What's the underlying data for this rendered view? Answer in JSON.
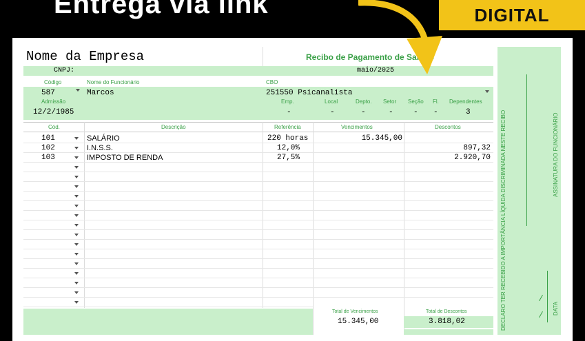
{
  "banner": {
    "title": "Entrega via link",
    "badge": "DIGITAL"
  },
  "header": {
    "company": "Nome da Empresa",
    "title": "Recibo de Pagamento de Salário",
    "cnpj_label": "CNPJ:",
    "period": "maio/2025"
  },
  "employee": {
    "labels": {
      "codigo": "Código",
      "nome": "Nome do Funcionário",
      "cbo": "CBO",
      "admissao": "Admissão",
      "emp": "Emp.",
      "local": "Local",
      "depto": "Depto.",
      "setor": "Setor",
      "secao": "Seção",
      "fl": "Fl.",
      "dependentes": "Dependentes"
    },
    "codigo": "587",
    "nome": "Marcos",
    "cbo": "251550 Psicanalista",
    "admissao": "12/2/1985",
    "emp": "-",
    "local": "-",
    "depto": "-",
    "setor": "-",
    "secao": "-",
    "fl": "-",
    "dependentes": "3"
  },
  "table": {
    "headers": {
      "cod": "Cód.",
      "descricao": "Descrição",
      "referencia": "Referência",
      "vencimentos": "Vencimentos",
      "descontos": "Descontos"
    },
    "rows": [
      {
        "cod": "101",
        "descricao": "SALÁRIO",
        "referencia": "220 horas",
        "vencimentos": "15.345,00",
        "descontos": ""
      },
      {
        "cod": "102",
        "descricao": "I.N.S.S.",
        "referencia": "12,0%",
        "vencimentos": "",
        "descontos": "897,32"
      },
      {
        "cod": "103",
        "descricao": "IMPOSTO DE RENDA",
        "referencia": "27,5%",
        "vencimentos": "",
        "descontos": "2.920,70"
      }
    ]
  },
  "totals": {
    "vencimentos_label": "Total de Vencimentos",
    "descontos_label": "Total de Descontos",
    "vencimentos": "15.345,00",
    "descontos": "3.818,02"
  },
  "sidebar": {
    "declaration": "DECLARO TER RECEBIDO A IMPORTÂNCIA LÍQUIDA DISCRIMINADA NESTE RECIBO",
    "signature": "ASSINATURA DO FUNCIONÁRIO",
    "date": "DATA"
  },
  "colors": {
    "green_fill": "#c9efcb",
    "green_text": "#3aa047",
    "badge_yellow": "#f2c318"
  }
}
